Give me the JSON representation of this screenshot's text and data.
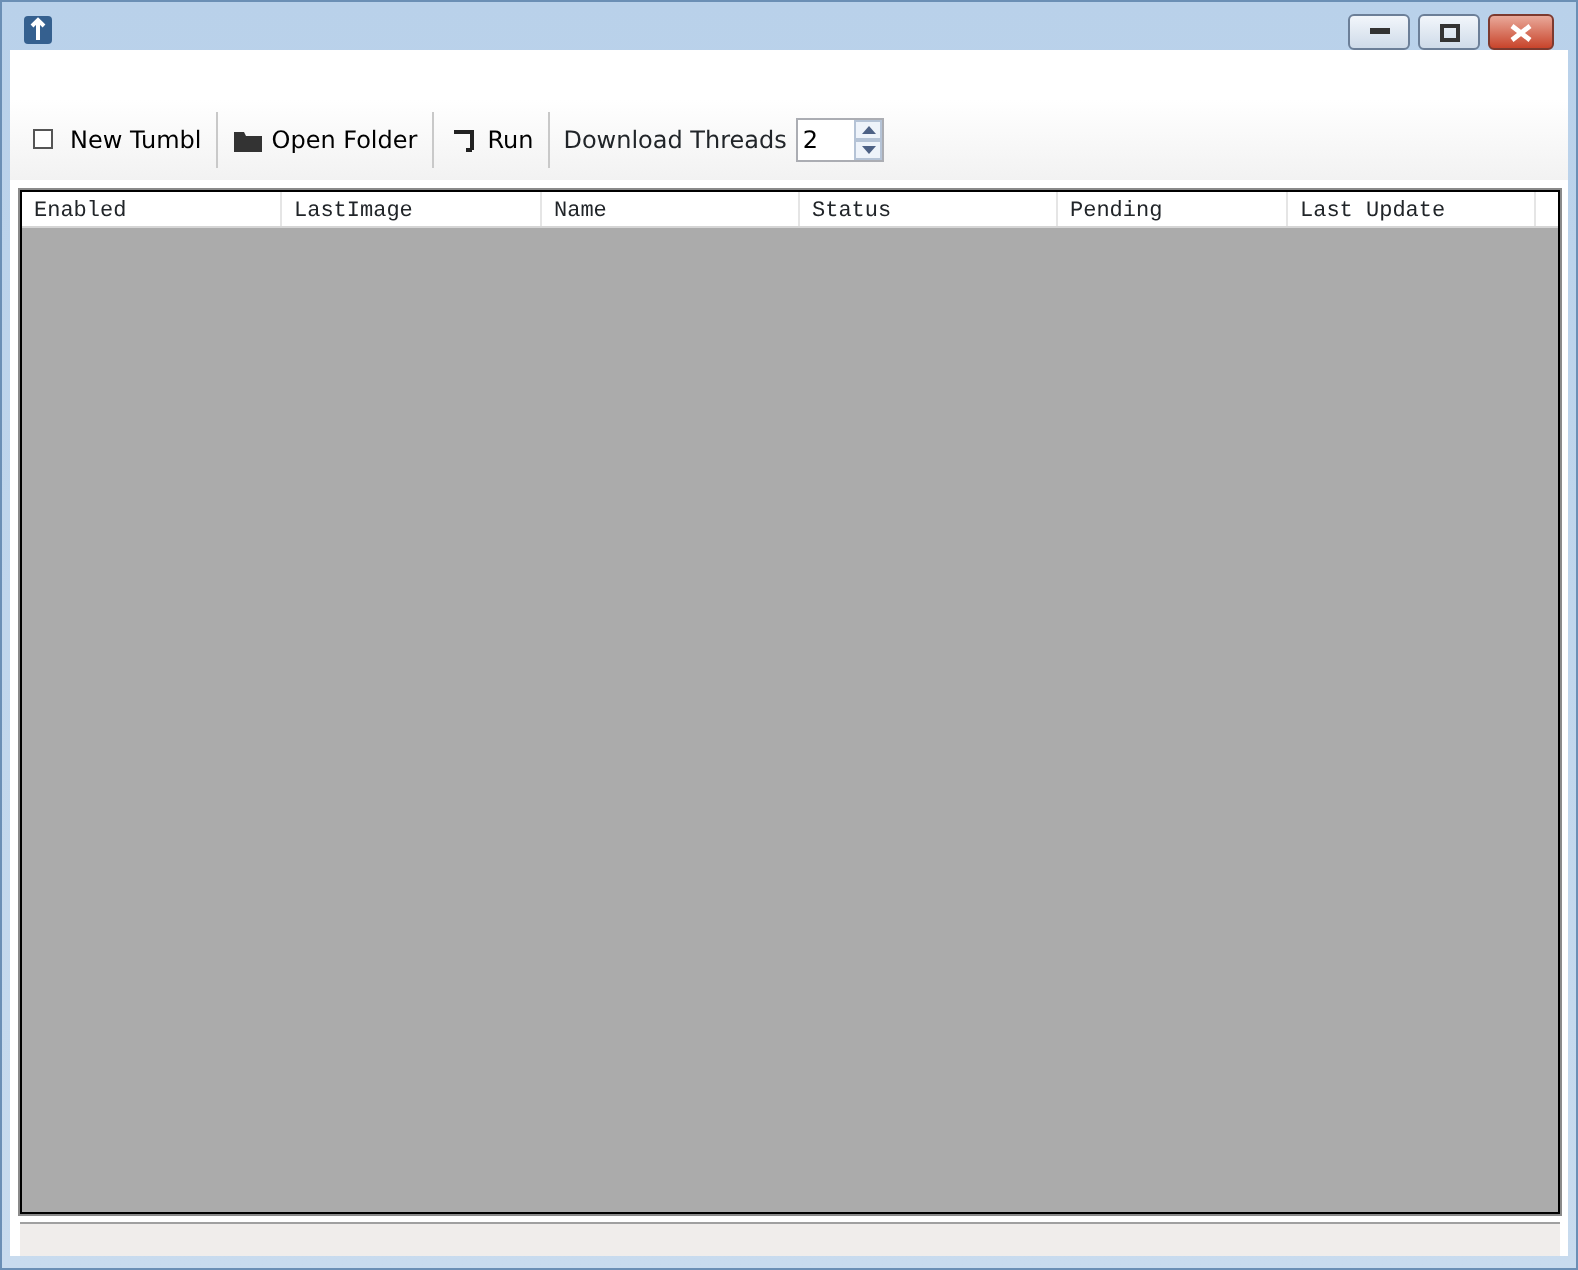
{
  "toolbar": [
    {
      "kind": "button",
      "label": "New Tumbl"
    },
    {
      "kind": "button",
      "label": "Open Folder"
    },
    {
      "kind": "button",
      "label": "Run"
    },
    {
      "kind": "spin",
      "label": "Download Threads",
      "value": "2"
    }
  ],
  "table": {
    "columns": [
      "Enabled",
      "LastImage",
      "Name",
      "Status",
      "Pending",
      "Last Update"
    ]
  }
}
